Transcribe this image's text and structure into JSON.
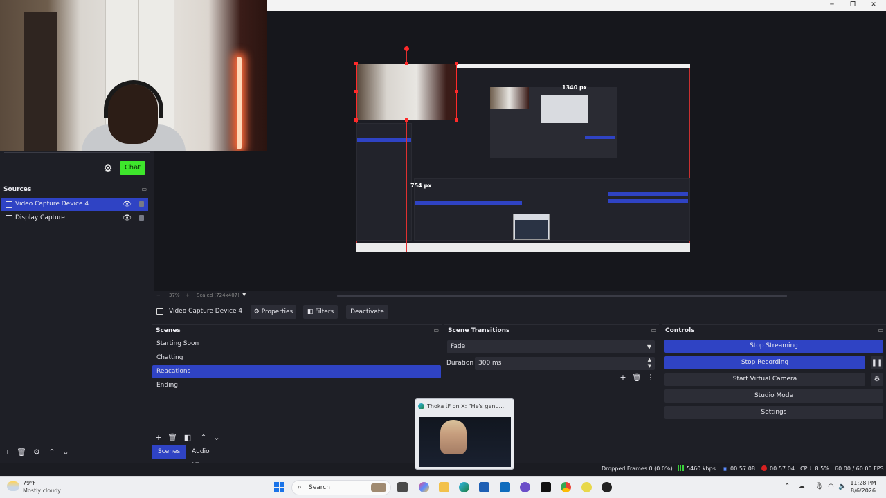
{
  "window": {
    "minimize": "─",
    "maximize": "❐",
    "close": "✕"
  },
  "chat_dock": {
    "chat_label": "Chat"
  },
  "sources": {
    "title": "Sources",
    "items": [
      {
        "label": "Video Capture Device 4",
        "selected": true
      },
      {
        "label": "Display Capture",
        "selected": false
      }
    ]
  },
  "preview": {
    "width_label": "1340 px",
    "height_label": "754 px",
    "zoom": "37%",
    "scale_label": "Scaled (724x407)"
  },
  "context_bar": {
    "source_name": "Video Capture Device 4",
    "properties_label": "Properties",
    "filters_label": "Filters",
    "deactivate_label": "Deactivate"
  },
  "scenes": {
    "title": "Scenes",
    "items": [
      {
        "label": "Starting Soon",
        "selected": false
      },
      {
        "label": "Chatting",
        "selected": false
      },
      {
        "label": "Reacations",
        "selected": true
      },
      {
        "label": "Ending",
        "selected": false
      }
    ]
  },
  "transitions": {
    "title": "Scene Transitions",
    "selected": "Fade",
    "duration_label": "Duration",
    "duration_value": "300 ms"
  },
  "controls": {
    "title": "Controls",
    "stop_streaming": "Stop Streaming",
    "stop_recording": "Stop Recording",
    "start_virtual_camera": "Start Virtual Camera",
    "studio_mode": "Studio Mode",
    "settings": "Settings"
  },
  "dock_tabs": {
    "scenes": "Scenes",
    "audio_mixer": "Audio Mixer"
  },
  "status": {
    "dropped_frames": "Dropped Frames 0 (0.0%)",
    "bitrate": "5460 kbps",
    "stream_time": "00:57:08",
    "rec_time": "00:57:04",
    "cpu": "CPU: 8.5%",
    "fps": "60.00 / 60.00 FPS"
  },
  "popup": {
    "title": "Thoka ἱF on X: \"He's genu..."
  },
  "taskbar": {
    "temperature": "79°F",
    "weather": "Mostly cloudy",
    "search_placeholder": "Search",
    "time": "11:28 PM",
    "date": "8/6/2026"
  },
  "colors": {
    "accent_blue": "#2f43c4",
    "chat_green": "#3ee62c",
    "selection_red": "#ff2a2a",
    "panel_bg": "#1e1f26"
  }
}
